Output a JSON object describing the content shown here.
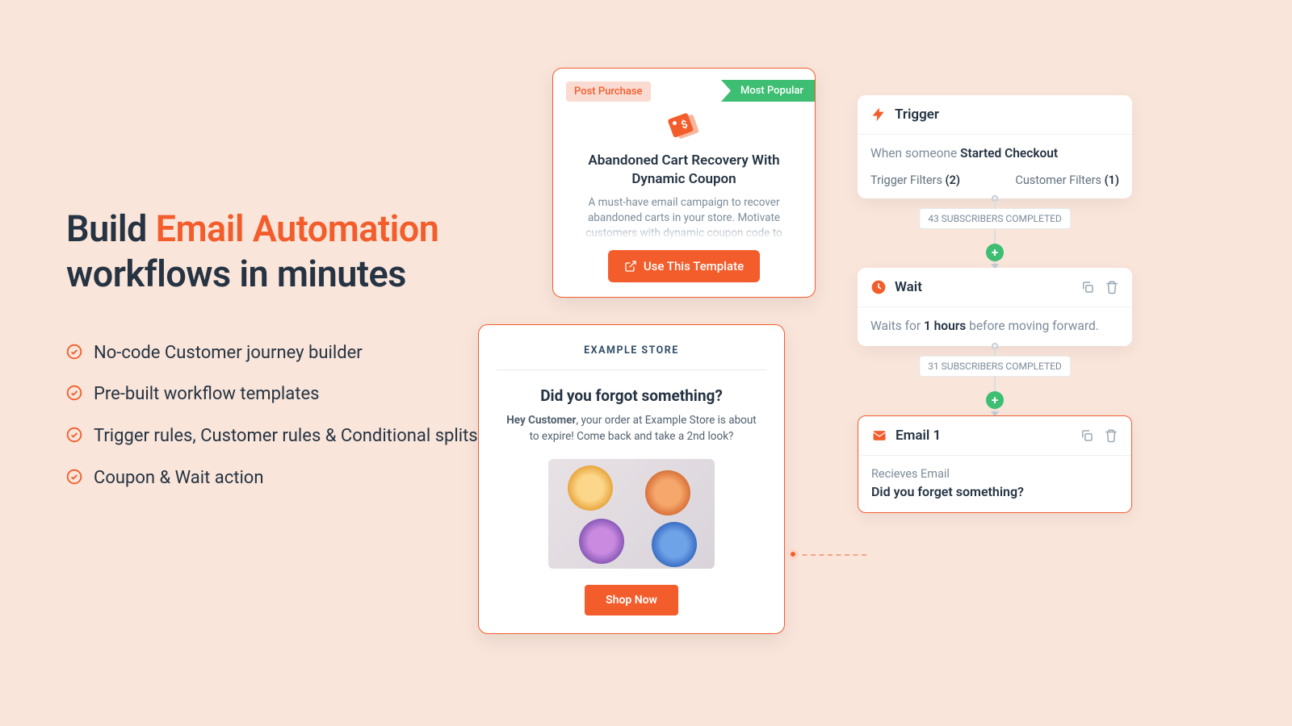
{
  "headline": {
    "prefix": "Build ",
    "accent": "Email Automation",
    "suffix": " workflows in minutes"
  },
  "features": [
    "No-code Customer journey builder",
    "Pre-built workflow templates",
    "Trigger rules, Customer rules & Conditional splits",
    "Coupon & Wait action"
  ],
  "template_card": {
    "badge": "Post Purchase",
    "ribbon": "Most Popular",
    "title": "Abandoned Cart Recovery With Dynamic Coupon",
    "description": "A must-have email campaign to recover abandoned carts in your store. Motivate customers with dynamic coupon code to",
    "cta": "Use This Template"
  },
  "email_preview": {
    "store": "EXAMPLE STORE",
    "title": "Did you forgot something?",
    "body_prefix": "Hey Customer",
    "body_rest": ", your order at Example Store is about to expire! Come back and take a 2nd look?",
    "cta": "Shop Now"
  },
  "flow": {
    "trigger": {
      "label": "Trigger",
      "text_prefix": "When someone ",
      "text_strong": "Started Checkout",
      "trigger_filters_label": "Trigger Filters ",
      "trigger_filters_count": "(2)",
      "customer_filters_label": "Customer Filters ",
      "customer_filters_count": "(1)"
    },
    "connector1": {
      "count": "43 SUBSCRIBERS COMPLETED"
    },
    "wait": {
      "label": "Wait",
      "text_prefix": "Waits for ",
      "text_strong": "1 hours",
      "text_suffix": " before moving forward."
    },
    "connector2": {
      "count": "31 SUBSCRIBERS COMPLETED"
    },
    "email1": {
      "label": "Email 1",
      "sub": "Recieves Email",
      "subject": "Did you forget something?"
    }
  },
  "colors": {
    "accent": "#F35D2C",
    "green": "#3DBE72"
  }
}
